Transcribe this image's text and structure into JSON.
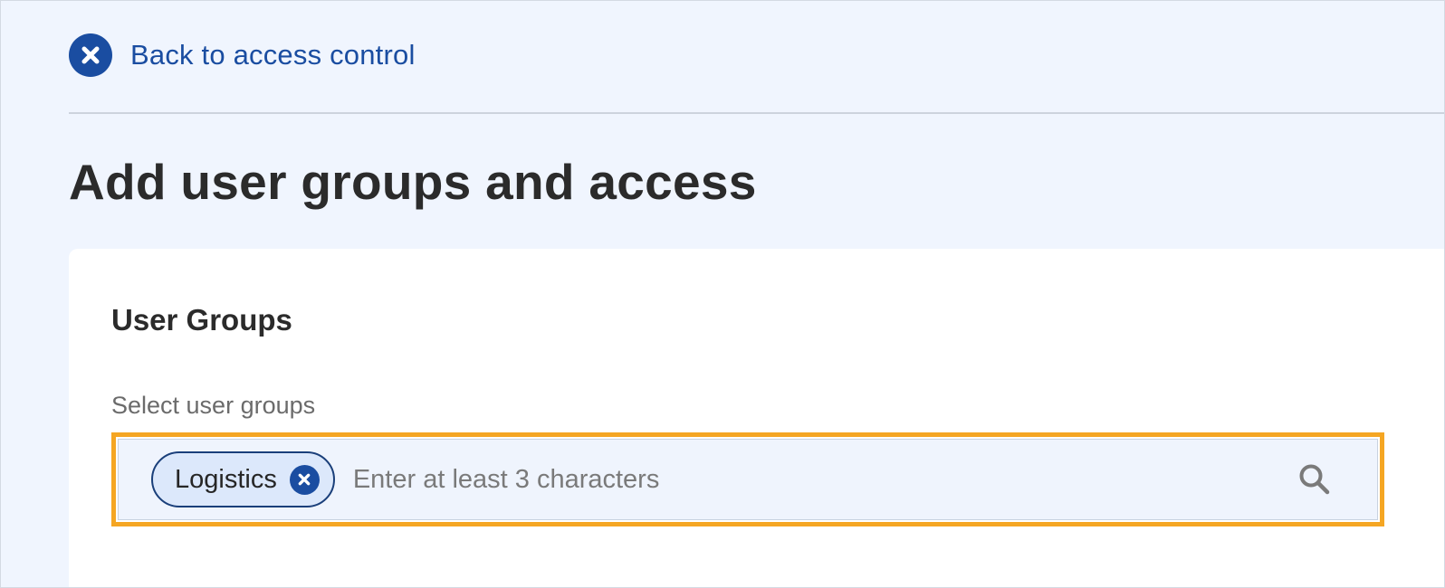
{
  "header": {
    "back_link_label": "Back to access control",
    "back_icon": "close-circle-icon"
  },
  "page": {
    "title": "Add user groups and access"
  },
  "user_groups": {
    "section_title": "User Groups",
    "field_label": "Select user groups",
    "selected_groups": [
      {
        "label": "Logistics",
        "remove_icon": "close-circle-icon"
      }
    ],
    "search": {
      "placeholder": "Enter at least 3 characters",
      "value": "",
      "icon": "search-icon"
    }
  },
  "colors": {
    "accent": "#1a4da1",
    "focus_ring": "#f5a623",
    "background": "#f0f5fe",
    "chip_background": "#dce8fb"
  }
}
